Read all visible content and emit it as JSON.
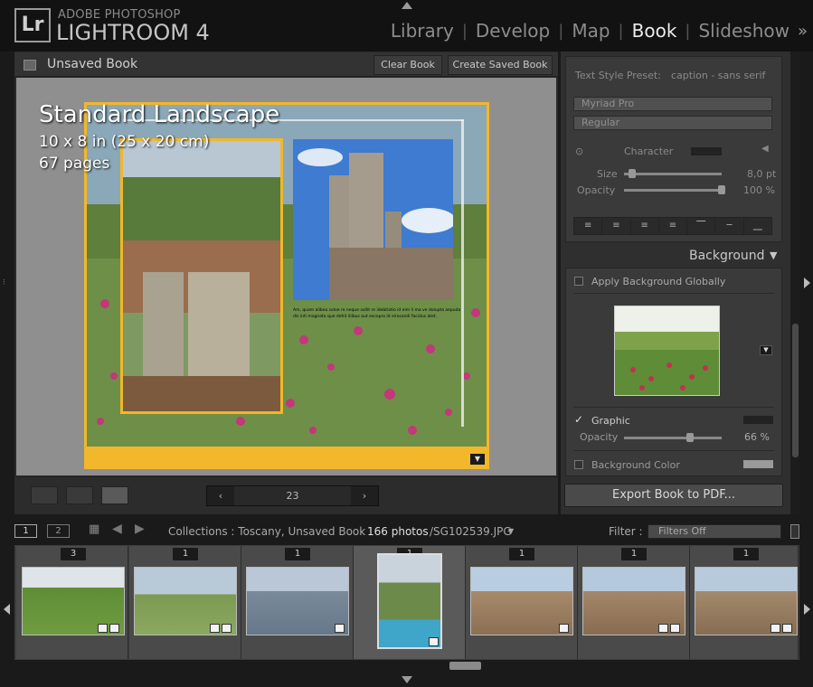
{
  "app": {
    "brand_top": "ADOBE PHOTOSHOP",
    "brand_main": "LIGHTROOM 4",
    "logo": "Lr",
    "modules": [
      "Library",
      "Develop",
      "Map",
      "Book",
      "Slideshow"
    ],
    "active_module": "Book",
    "more_modules": "»"
  },
  "book_toolbar": {
    "book_name": "Unsaved Book",
    "clear_label": "Clear Book",
    "create_label": "Create Saved Book"
  },
  "book_info": {
    "format": "Standard Landscape",
    "size": "10 x 8 in (25 x 20 cm)",
    "pages": "67 pages"
  },
  "caption_text": "Am, quam alibea soloe re neque sollit re idebitatio id eim li ma ve dolupta aepuda dis inti magnato que dehit illibus aut excepro id eirosandi facidus atet.",
  "work_toolbar": {
    "page_number": "23",
    "prev": "‹",
    "next": "›"
  },
  "right_panel": {
    "text_style_label": "Text Style Preset:",
    "text_style_value": "caption - sans serif",
    "font_family": "Myriad Pro",
    "font_style": "Regular",
    "character_label": "Character",
    "size_label": "Size",
    "size_value": "8,0 pt",
    "size_level": 0.05,
    "opacity_label": "Opacity",
    "opacity_value": "100 %",
    "opacity_level": 1.0,
    "background_header": "Background",
    "apply_globally": "Apply Background Globally",
    "graphic_label": "Graphic",
    "graphic_opacity_label": "Opacity",
    "graphic_opacity_value": "66 %",
    "graphic_opacity_level": 0.66,
    "bg_color_label": "Background Color",
    "export_label": "Export Book to PDF..."
  },
  "filmstrip_bar": {
    "page1": "1",
    "page2": "2",
    "collections": "Collections : Toscany, Unsaved Book",
    "count": "166 photos",
    "file": "/SG102539.JPG",
    "filter_label": "Filter :",
    "filter_value": "Filters Off"
  },
  "filmstrip": {
    "badges": [
      "3",
      "1",
      "1",
      "1",
      "1",
      "1",
      "1"
    ]
  },
  "colors": {
    "accent_yellow": "#f2b72a",
    "panel_bg": "#3a3a3a"
  }
}
